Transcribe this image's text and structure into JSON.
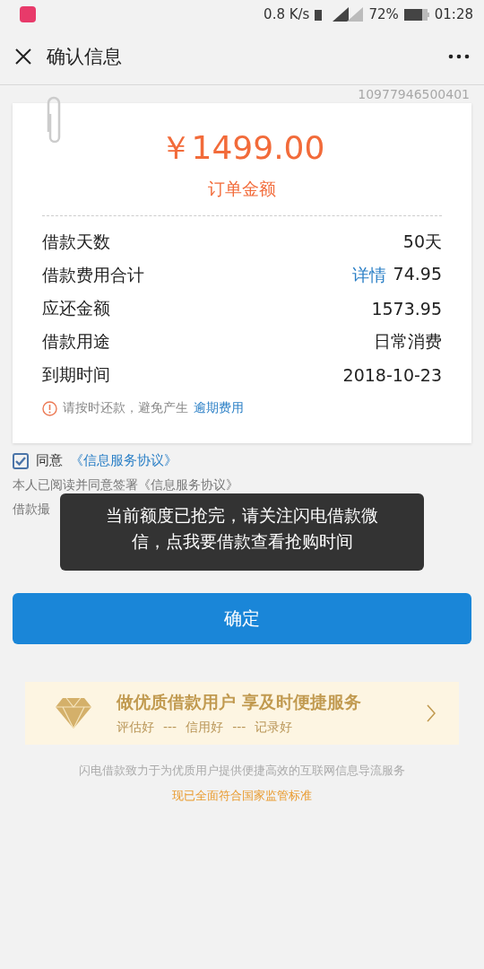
{
  "status_bar": {
    "speed": "0.8 K/s",
    "battery": "72%",
    "time": "01:28"
  },
  "header": {
    "title": "确认信息"
  },
  "order_no": "10977946500401",
  "amount": {
    "value": "￥1499.00",
    "label": "订单金额"
  },
  "rows": [
    {
      "label": "借款天数",
      "value": "50天"
    },
    {
      "label": "借款费用合计",
      "link": "详情",
      "value": "74.95"
    },
    {
      "label": "应还金额",
      "value": "1573.95"
    },
    {
      "label": "借款用途",
      "value": "日常消费"
    },
    {
      "label": "到期时间",
      "value": "2018-10-23"
    }
  ],
  "notice": {
    "text": "请按时还款，避免产生",
    "link": "逾期费用"
  },
  "agreement": {
    "checked": true,
    "text": "同意",
    "link": "《信息服务协议》"
  },
  "terms": [
    "本人已阅读并同意签署《信息服务协议》",
    "借款撮"
  ],
  "toast": "当前额度已抢完，请关注闪电借款微信，点我要借款查看抢购时间",
  "confirm_button": "确定",
  "banner": {
    "title": "做优质借款用户 享及时便捷服务",
    "tags": [
      "评估好",
      "---",
      "信用好",
      "---",
      "记录好"
    ]
  },
  "footer": [
    "闪电借款致力于为优质用户提供便捷高效的互联网信息导流服务",
    "现已全面符合国家监管标准"
  ]
}
